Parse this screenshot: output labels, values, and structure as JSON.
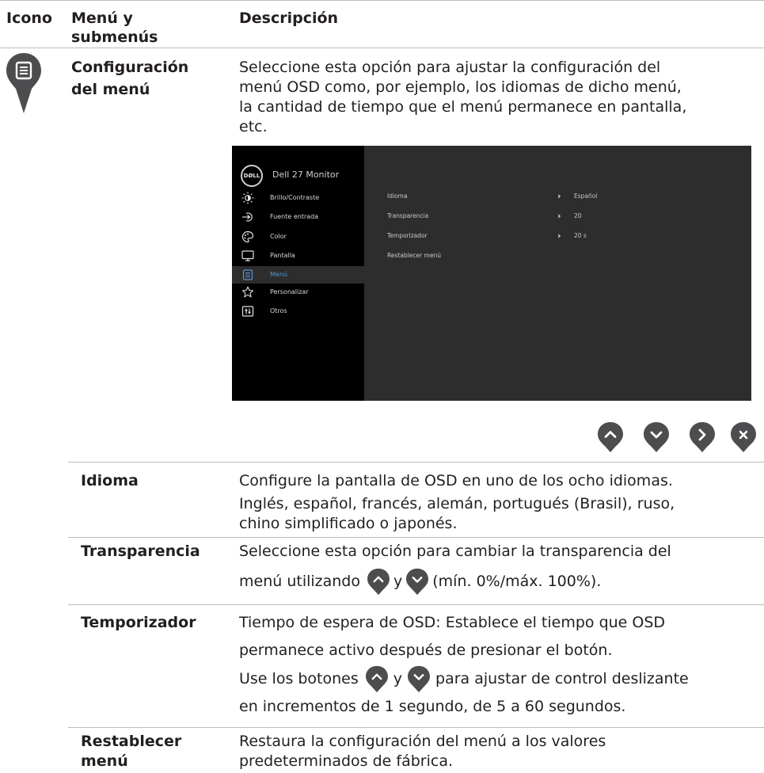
{
  "header": {
    "col_icon": "Icono",
    "col_menu_line1": "Menú y",
    "col_menu_line2": "submenús",
    "col_desc": "Descripción"
  },
  "main": {
    "icon_name": "menu-pin-icon",
    "name_line1": "Configuración",
    "name_line2": "del menú",
    "desc_lines": [
      "Seleccione esta opción para ajustar la configuración del",
      "menú OSD como, por ejemplo, los idiomas de dicho menú,",
      "la cantidad de tiempo que el menú permanece en pantalla,",
      "etc."
    ]
  },
  "osd": {
    "logo": "DØLL",
    "model": "Dell 27 Monitor",
    "menu": [
      {
        "label": "Brillo/Contraste",
        "icon": "brightness-icon"
      },
      {
        "label": "Fuente entrada",
        "icon": "input-source-icon"
      },
      {
        "label": "Color",
        "icon": "color-palette-icon"
      },
      {
        "label": "Pantalla",
        "icon": "display-icon"
      },
      {
        "label": "Menú",
        "icon": "menu-icon",
        "selected": true
      },
      {
        "label": "Personalizar",
        "icon": "star-icon"
      },
      {
        "label": "Otros",
        "icon": "others-icon"
      }
    ],
    "settings": [
      {
        "label": "Idioma",
        "value": "Español"
      },
      {
        "label": "Transparencia",
        "value": "20"
      },
      {
        "label": "Temporizador",
        "value": "20 s"
      },
      {
        "label": "Restablecer menú",
        "value": ""
      }
    ],
    "highlight_color": "#5b93d1"
  },
  "nav_buttons": [
    "up-pin-icon",
    "down-pin-icon",
    "right-pin-icon",
    "close-pin-icon"
  ],
  "rows": [
    {
      "name": "Idioma",
      "lines": [
        "Configure la pantalla de OSD en uno de los ocho idiomas.",
        "Inglés, español, francés, alemán, portugués (Brasil), ruso,",
        "chino simplificado o japonés."
      ]
    },
    {
      "name": "Transparencia",
      "line1": "Seleccione esta opción para cambiar la transparencia del",
      "line2_a": "menú utilizando",
      "line2_b": "y",
      "line2_c": "(mín. 0%/máx. 100%)."
    },
    {
      "name": "Temporizador",
      "line1": "Tiempo de espera de OSD: Establece el tiempo que OSD",
      "line2": "permanece activo después de presionar el botón.",
      "line3_a": "Use los botones",
      "line3_b": "y",
      "line3_c": "para ajustar de control deslizante",
      "line4": "en incrementos de 1 segundo, de 5 a 60 segundos."
    },
    {
      "name_line1": "Restablecer",
      "name_line2": "menú",
      "line1": "Restaura la configuración del menú a los valores",
      "line2": "predeterminados de fábrica."
    }
  ],
  "colors": {
    "pin": "#4d4d4f",
    "rule": "#bcbcbc",
    "text": "#231f20"
  }
}
